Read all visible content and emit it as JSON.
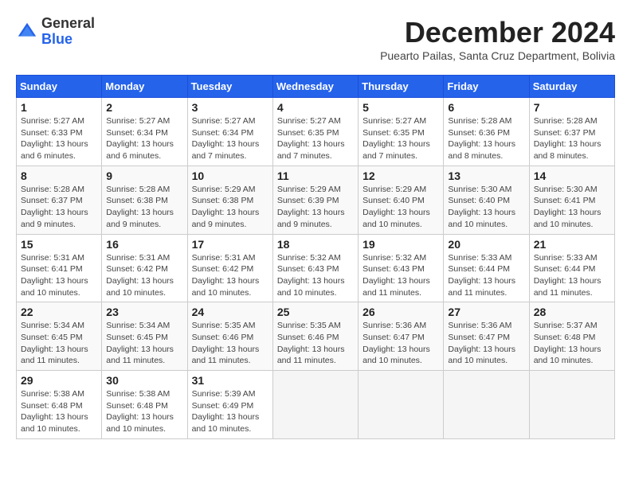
{
  "header": {
    "title": "December 2024",
    "subtitle": "Puearto Pailas, Santa Cruz Department, Bolivia",
    "logo_general": "General",
    "logo_blue": "Blue"
  },
  "calendar": {
    "days_of_week": [
      "Sunday",
      "Monday",
      "Tuesday",
      "Wednesday",
      "Thursday",
      "Friday",
      "Saturday"
    ],
    "weeks": [
      [
        {
          "day": "1",
          "sunrise": "5:27 AM",
          "sunset": "6:33 PM",
          "daylight": "13 hours and 6 minutes."
        },
        {
          "day": "2",
          "sunrise": "5:27 AM",
          "sunset": "6:34 PM",
          "daylight": "13 hours and 6 minutes."
        },
        {
          "day": "3",
          "sunrise": "5:27 AM",
          "sunset": "6:34 PM",
          "daylight": "13 hours and 7 minutes."
        },
        {
          "day": "4",
          "sunrise": "5:27 AM",
          "sunset": "6:35 PM",
          "daylight": "13 hours and 7 minutes."
        },
        {
          "day": "5",
          "sunrise": "5:27 AM",
          "sunset": "6:35 PM",
          "daylight": "13 hours and 7 minutes."
        },
        {
          "day": "6",
          "sunrise": "5:28 AM",
          "sunset": "6:36 PM",
          "daylight": "13 hours and 8 minutes."
        },
        {
          "day": "7",
          "sunrise": "5:28 AM",
          "sunset": "6:37 PM",
          "daylight": "13 hours and 8 minutes."
        }
      ],
      [
        {
          "day": "8",
          "sunrise": "5:28 AM",
          "sunset": "6:37 PM",
          "daylight": "13 hours and 9 minutes."
        },
        {
          "day": "9",
          "sunrise": "5:28 AM",
          "sunset": "6:38 PM",
          "daylight": "13 hours and 9 minutes."
        },
        {
          "day": "10",
          "sunrise": "5:29 AM",
          "sunset": "6:38 PM",
          "daylight": "13 hours and 9 minutes."
        },
        {
          "day": "11",
          "sunrise": "5:29 AM",
          "sunset": "6:39 PM",
          "daylight": "13 hours and 9 minutes."
        },
        {
          "day": "12",
          "sunrise": "5:29 AM",
          "sunset": "6:40 PM",
          "daylight": "13 hours and 10 minutes."
        },
        {
          "day": "13",
          "sunrise": "5:30 AM",
          "sunset": "6:40 PM",
          "daylight": "13 hours and 10 minutes."
        },
        {
          "day": "14",
          "sunrise": "5:30 AM",
          "sunset": "6:41 PM",
          "daylight": "13 hours and 10 minutes."
        }
      ],
      [
        {
          "day": "15",
          "sunrise": "5:31 AM",
          "sunset": "6:41 PM",
          "daylight": "13 hours and 10 minutes."
        },
        {
          "day": "16",
          "sunrise": "5:31 AM",
          "sunset": "6:42 PM",
          "daylight": "13 hours and 10 minutes."
        },
        {
          "day": "17",
          "sunrise": "5:31 AM",
          "sunset": "6:42 PM",
          "daylight": "13 hours and 10 minutes."
        },
        {
          "day": "18",
          "sunrise": "5:32 AM",
          "sunset": "6:43 PM",
          "daylight": "13 hours and 10 minutes."
        },
        {
          "day": "19",
          "sunrise": "5:32 AM",
          "sunset": "6:43 PM",
          "daylight": "13 hours and 11 minutes."
        },
        {
          "day": "20",
          "sunrise": "5:33 AM",
          "sunset": "6:44 PM",
          "daylight": "13 hours and 11 minutes."
        },
        {
          "day": "21",
          "sunrise": "5:33 AM",
          "sunset": "6:44 PM",
          "daylight": "13 hours and 11 minutes."
        }
      ],
      [
        {
          "day": "22",
          "sunrise": "5:34 AM",
          "sunset": "6:45 PM",
          "daylight": "13 hours and 11 minutes."
        },
        {
          "day": "23",
          "sunrise": "5:34 AM",
          "sunset": "6:45 PM",
          "daylight": "13 hours and 11 minutes."
        },
        {
          "day": "24",
          "sunrise": "5:35 AM",
          "sunset": "6:46 PM",
          "daylight": "13 hours and 11 minutes."
        },
        {
          "day": "25",
          "sunrise": "5:35 AM",
          "sunset": "6:46 PM",
          "daylight": "13 hours and 11 minutes."
        },
        {
          "day": "26",
          "sunrise": "5:36 AM",
          "sunset": "6:47 PM",
          "daylight": "13 hours and 10 minutes."
        },
        {
          "day": "27",
          "sunrise": "5:36 AM",
          "sunset": "6:47 PM",
          "daylight": "13 hours and 10 minutes."
        },
        {
          "day": "28",
          "sunrise": "5:37 AM",
          "sunset": "6:48 PM",
          "daylight": "13 hours and 10 minutes."
        }
      ],
      [
        {
          "day": "29",
          "sunrise": "5:38 AM",
          "sunset": "6:48 PM",
          "daylight": "13 hours and 10 minutes."
        },
        {
          "day": "30",
          "sunrise": "5:38 AM",
          "sunset": "6:48 PM",
          "daylight": "13 hours and 10 minutes."
        },
        {
          "day": "31",
          "sunrise": "5:39 AM",
          "sunset": "6:49 PM",
          "daylight": "13 hours and 10 minutes."
        },
        null,
        null,
        null,
        null
      ]
    ]
  }
}
